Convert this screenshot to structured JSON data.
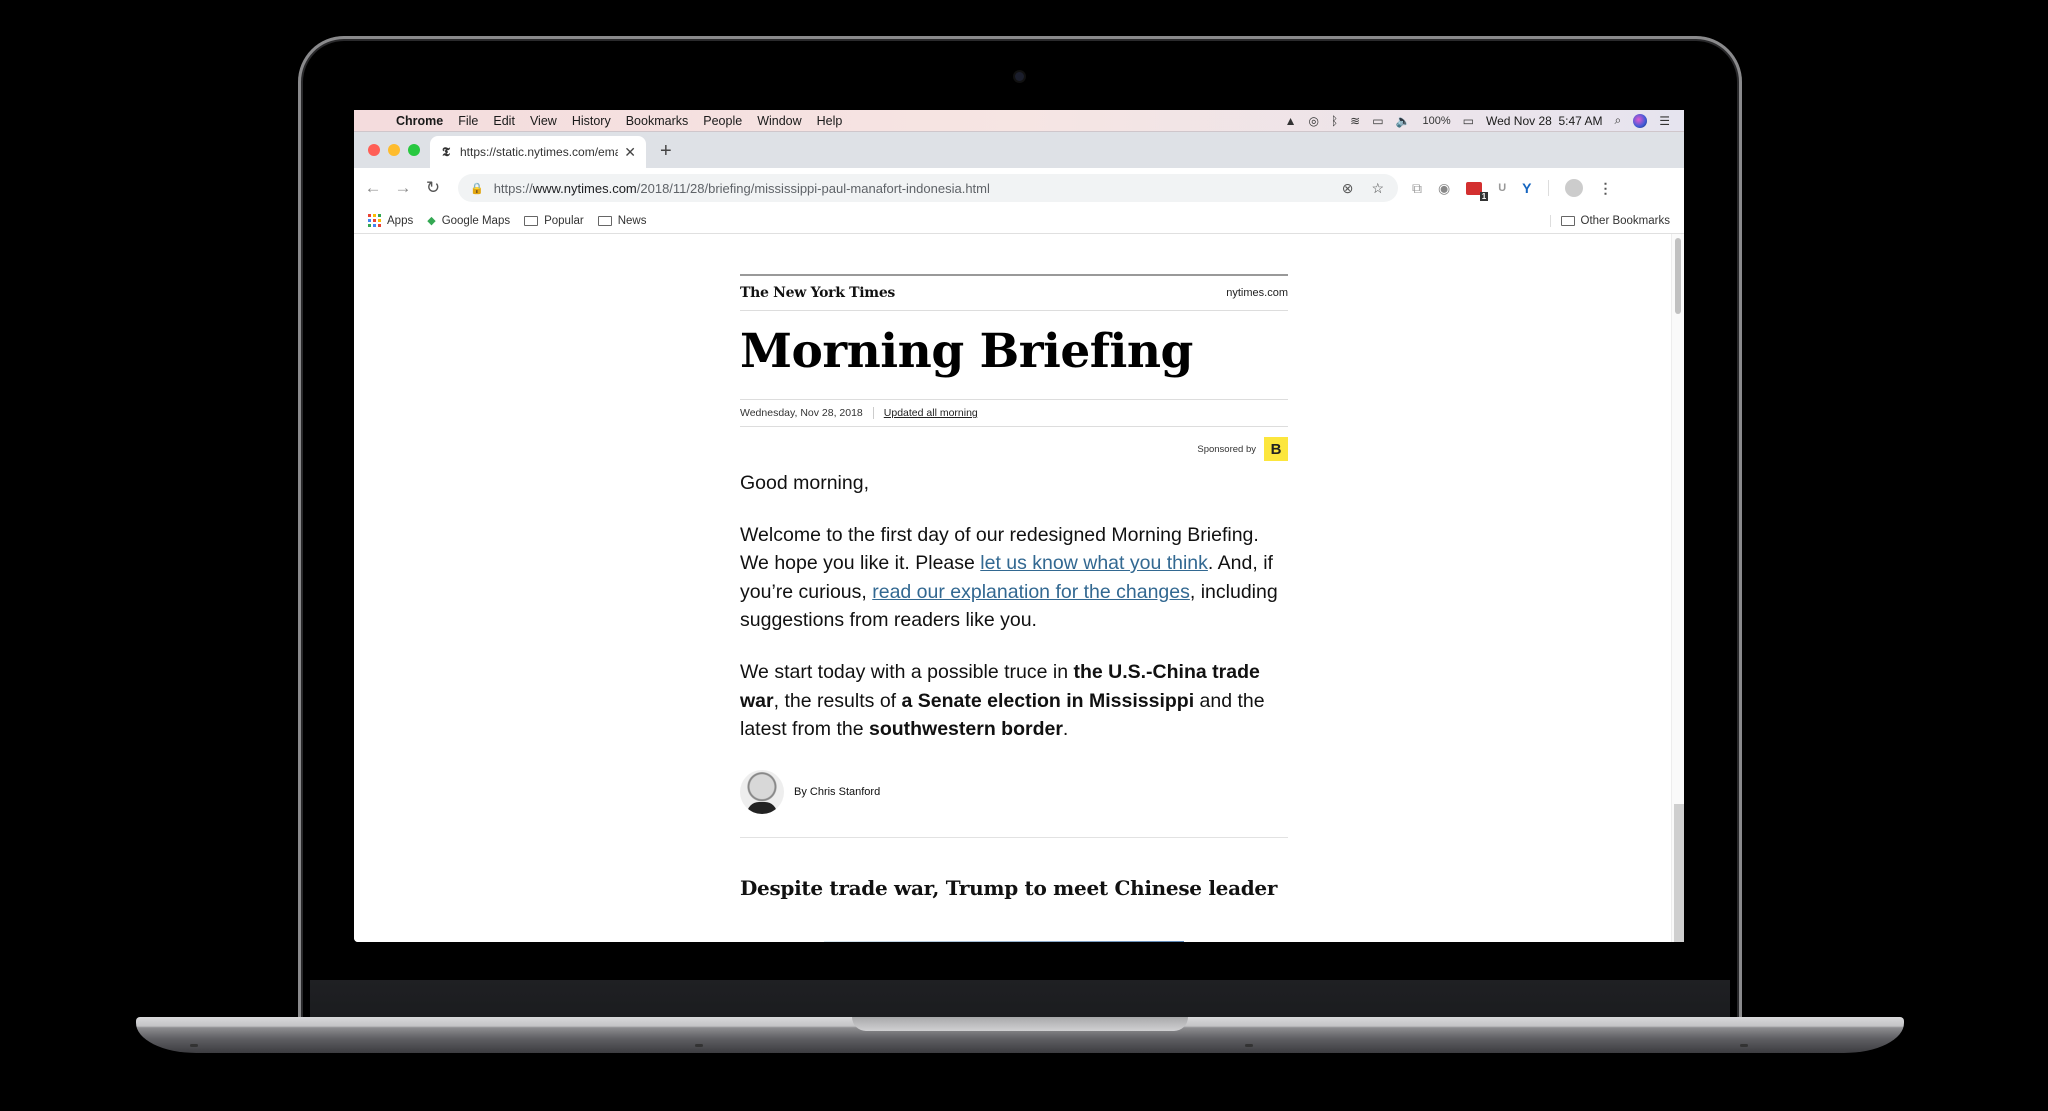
{
  "menubar": {
    "app": "Chrome",
    "items": [
      "File",
      "Edit",
      "View",
      "History",
      "Bookmarks",
      "People",
      "Window",
      "Help"
    ],
    "battery": "100%",
    "clock": "Wed Nov 28  5:47 AM"
  },
  "tab": {
    "title": "https://static.nytimes.com/email",
    "favicon": "𝕿",
    "close": "✕",
    "new_tab": "+"
  },
  "omnibox": {
    "scheme": "https://",
    "host": "www.nytimes.com",
    "path": "/2018/11/28/briefing/mississippi-paul-manafort-indonesia.html"
  },
  "extensions": {
    "lastpass_badge": "1"
  },
  "bookmarks": {
    "items": [
      {
        "label": "Apps",
        "icon": "apps-grid"
      },
      {
        "label": "Google Maps",
        "icon": "maps"
      },
      {
        "label": "Popular",
        "icon": "folder"
      },
      {
        "label": "News",
        "icon": "folder"
      }
    ],
    "other": "Other Bookmarks"
  },
  "article": {
    "masthead_logo": "The New York Times",
    "masthead_site": "nytimes.com",
    "headline": "Morning Briefing",
    "date": "Wednesday, Nov 28, 2018",
    "updated": "Updated all morning",
    "sponsored_by": "Sponsored by",
    "sponsor_logo": "B",
    "greeting": "Good morning,",
    "p1_a": "Welcome to the first day of our redesigned Morning Briefing. We hope you like it. Please ",
    "p1_link1": "let us know what you think",
    "p1_b": ". And, if you’re curious, ",
    "p1_link2": "read our explanation for the changes",
    "p1_c": ", including suggestions from readers like you.",
    "p2_a": "We start today with a possible truce in ",
    "p2_b1": "the U.S.-China trade war",
    "p2_c": ", the results of ",
    "p2_b2": "a Senate election in Mississippi",
    "p2_d": " and the latest from the ",
    "p2_b3": "southwestern border",
    "p2_e": ".",
    "byline": "By Chris Stanford",
    "story_headline": "Despite trade war, Trump to meet Chinese leader"
  },
  "colors": {
    "link": "#326891",
    "close_red": "#ff5f57",
    "min_yellow": "#febc2e",
    "max_green": "#28c840",
    "sponsor_yellow": "#fce63d"
  }
}
